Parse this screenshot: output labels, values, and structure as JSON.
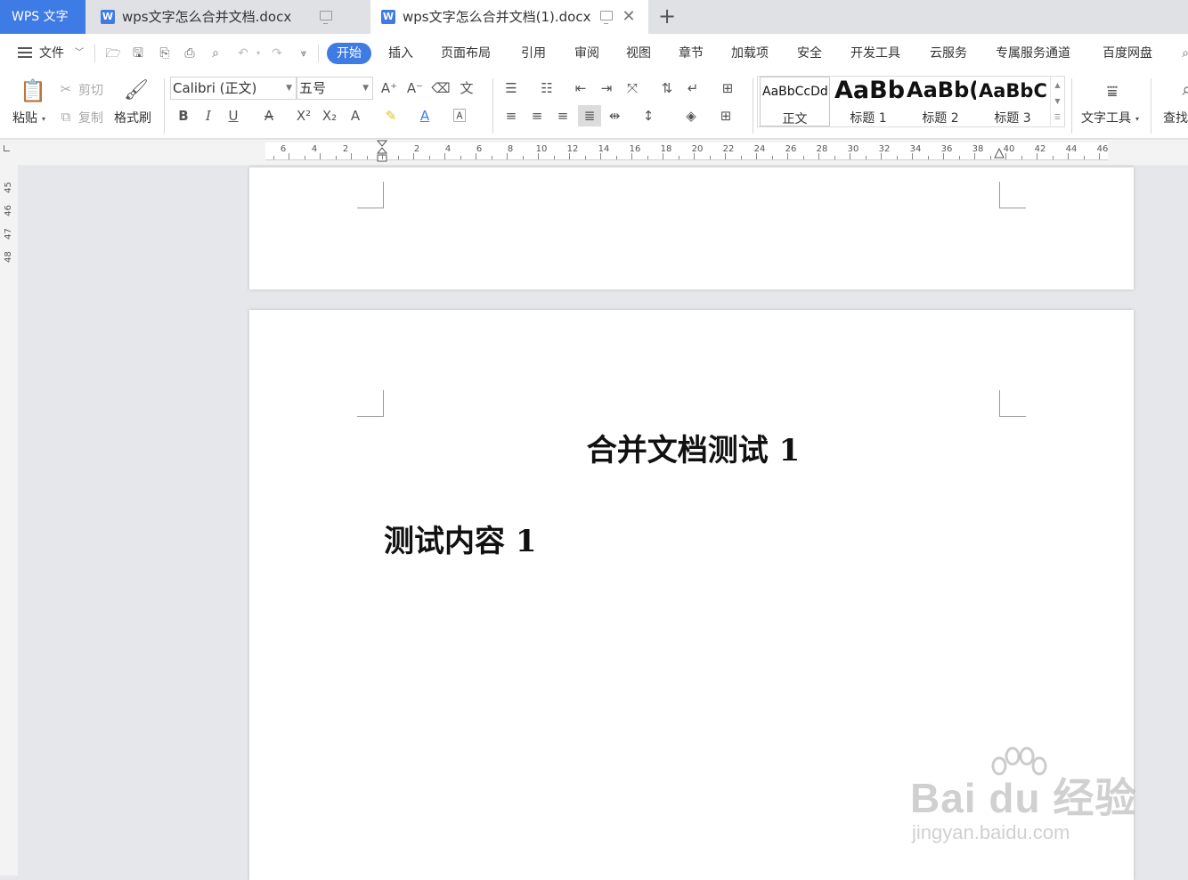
{
  "tabs": {
    "app_label": "WPS 文字",
    "inactive_doc": "wps文字怎么合并文档.docx",
    "active_doc": "wps文字怎么合并文档(1).docx",
    "new_tab": "+",
    "doc_icon": "W"
  },
  "menu": {
    "file": "文件",
    "items": [
      "开始",
      "插入",
      "页面布局",
      "引用",
      "审阅",
      "视图",
      "章节",
      "加载项",
      "安全",
      "开发工具",
      "云服务",
      "专属服务通道",
      "百度网盘"
    ]
  },
  "ribbon": {
    "paste": "粘贴",
    "cut": "剪切",
    "copy": "复制",
    "format_painter": "格式刷",
    "font_name": "Calibri (正文)",
    "font_size": "五号",
    "styles": [
      {
        "sample": "AaBbCcDd",
        "name": "正文"
      },
      {
        "sample": "AaBb",
        "name": "标题 1"
      },
      {
        "sample": "AaBb(",
        "name": "标题 2"
      },
      {
        "sample": "AaBbC(",
        "name": "标题 3"
      }
    ],
    "text_tools": "文字工具",
    "find": "查找"
  },
  "ruler": {
    "left_numbers": [
      "6",
      "4",
      "2"
    ],
    "right_numbers": [
      "2",
      "4",
      "6",
      "8",
      "10",
      "12",
      "14",
      "16",
      "18",
      "20",
      "22",
      "24",
      "26",
      "28",
      "30",
      "32",
      "34",
      "36",
      "38",
      "40",
      "42",
      "44",
      "46"
    ],
    "vertical_numbers": [
      "45",
      "46",
      "47",
      "48"
    ]
  },
  "document": {
    "title": "合并文档测试 1",
    "body": "测试内容 1"
  },
  "watermark": {
    "brand": "Bai du 经验",
    "url": "jingyan.baidu.com"
  },
  "colors": {
    "accent": "#3f7be5"
  }
}
